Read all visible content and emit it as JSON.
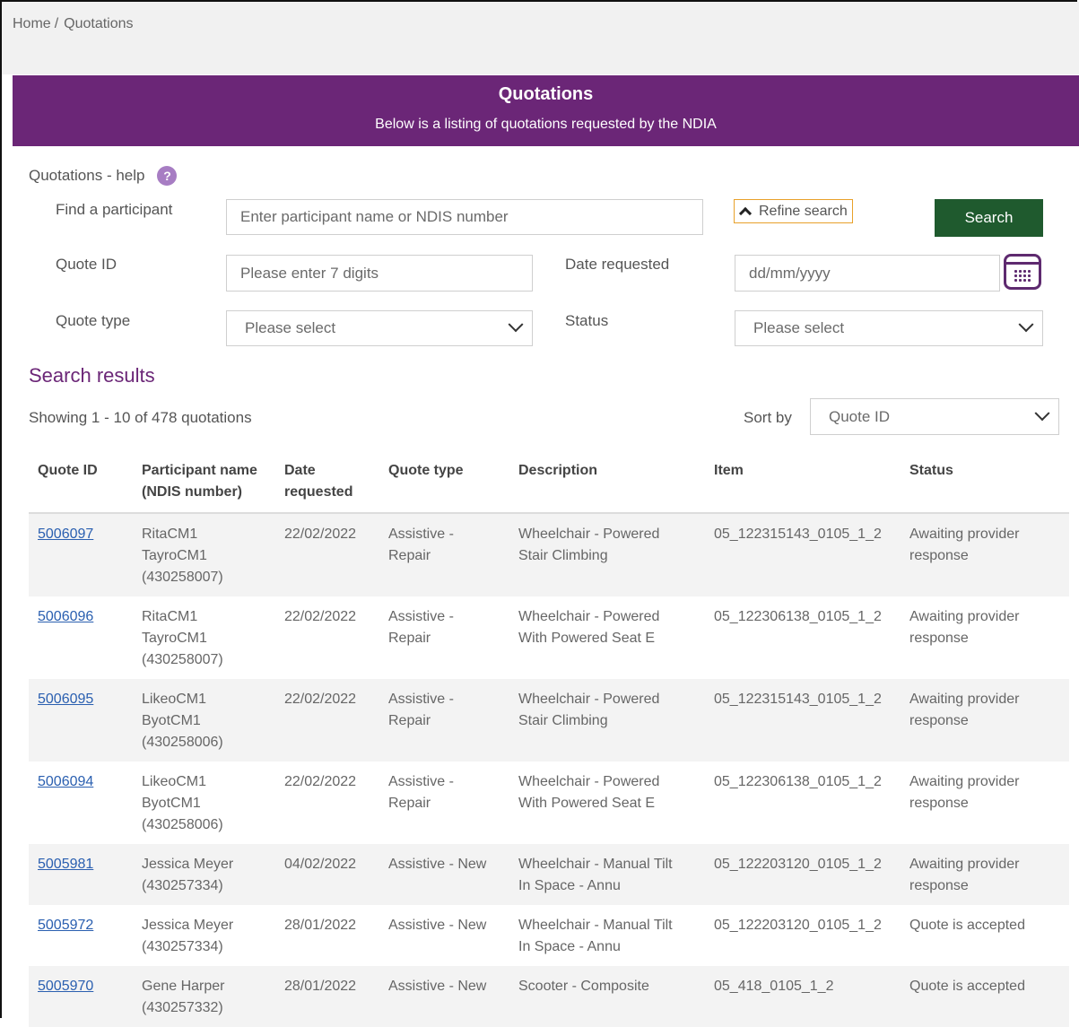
{
  "breadcrumb": {
    "home": "Home",
    "current": "Quotations"
  },
  "banner": {
    "title": "Quotations",
    "subtitle": "Below is a listing of quotations requested by the NDIA"
  },
  "help": {
    "label": "Quotations - help",
    "icon": "?"
  },
  "form": {
    "participant_label": "Find a participant",
    "participant_placeholder": "Enter participant name or NDIS number",
    "refine_label": "Refine search",
    "search_label": "Search",
    "quote_id_label": "Quote ID",
    "quote_id_placeholder": "Please enter 7 digits",
    "date_label": "Date requested",
    "date_placeholder": "dd/mm/yyyy",
    "quote_type_label": "Quote type",
    "quote_type_value": "Please select",
    "status_label": "Status",
    "status_value": "Please select"
  },
  "results": {
    "title": "Search results",
    "showing": "Showing 1 - 10 of 478 quotations",
    "sort_label": "Sort by",
    "sort_value": "Quote ID"
  },
  "table": {
    "headers": {
      "quote_id": "Quote ID",
      "participant_1": "Participant name",
      "participant_2": "(NDIS number)",
      "date_1": "Date",
      "date_2": "requested",
      "type": "Quote type",
      "description": "Description",
      "item": "Item",
      "status": "Status"
    },
    "rows": [
      {
        "id": "5006097",
        "p1": "RitaCM1",
        "p2": "TayroCM1",
        "p3": "(430258007)",
        "date": "22/02/2022",
        "t1": "Assistive -",
        "t2": "Repair",
        "d1": "Wheelchair - Powered",
        "d2": "Stair Climbing",
        "item": "05_122315143_0105_1_2",
        "s1": "Awaiting provider",
        "s2": "response"
      },
      {
        "id": "5006096",
        "p1": "RitaCM1",
        "p2": "TayroCM1",
        "p3": "(430258007)",
        "date": "22/02/2022",
        "t1": "Assistive -",
        "t2": "Repair",
        "d1": "Wheelchair - Powered",
        "d2": "With Powered Seat E",
        "item": "05_122306138_0105_1_2",
        "s1": "Awaiting provider",
        "s2": "response"
      },
      {
        "id": "5006095",
        "p1": "LikeoCM1",
        "p2": "ByotCM1",
        "p3": "(430258006)",
        "date": "22/02/2022",
        "t1": "Assistive -",
        "t2": "Repair",
        "d1": "Wheelchair - Powered",
        "d2": "Stair Climbing",
        "item": "05_122315143_0105_1_2",
        "s1": "Awaiting provider",
        "s2": "response"
      },
      {
        "id": "5006094",
        "p1": "LikeoCM1",
        "p2": "ByotCM1",
        "p3": "(430258006)",
        "date": "22/02/2022",
        "t1": "Assistive -",
        "t2": "Repair",
        "d1": "Wheelchair - Powered",
        "d2": "With Powered Seat E",
        "item": "05_122306138_0105_1_2",
        "s1": "Awaiting provider",
        "s2": "response"
      },
      {
        "id": "5005981",
        "p1": "Jessica Meyer",
        "p2": "(430257334)",
        "p3": "",
        "date": "04/02/2022",
        "t1": "Assistive - New",
        "t2": "",
        "d1": "Wheelchair - Manual Tilt",
        "d2": "In Space - Annu",
        "item": "05_122203120_0105_1_2",
        "s1": "Awaiting provider",
        "s2": "response"
      },
      {
        "id": "5005972",
        "p1": "Jessica Meyer",
        "p2": "(430257334)",
        "p3": "",
        "date": "28/01/2022",
        "t1": "Assistive - New",
        "t2": "",
        "d1": "Wheelchair - Manual Tilt",
        "d2": "In Space - Annu",
        "item": "05_122203120_0105_1_2",
        "s1": "Quote is accepted",
        "s2": ""
      },
      {
        "id": "5005970",
        "p1": "Gene Harper",
        "p2": "(430257332)",
        "p3": "",
        "date": "28/01/2022",
        "t1": "Assistive - New",
        "t2": "",
        "d1": "Scooter - Composite",
        "d2": "",
        "item": "05_418_0105_1_2",
        "s1": "Quote is accepted",
        "s2": ""
      }
    ]
  },
  "colors": {
    "banner": "#6b2677",
    "search_button": "#1f5a2e",
    "link": "#2a5fb0",
    "row_shade": "#f3f3f3",
    "refine_border": "#e8a12a"
  },
  "icons": {
    "help": "question-circle-icon",
    "refine": "chevron-up-icon",
    "calendar": "calendar-icon",
    "dropdown": "chevron-down-icon"
  }
}
